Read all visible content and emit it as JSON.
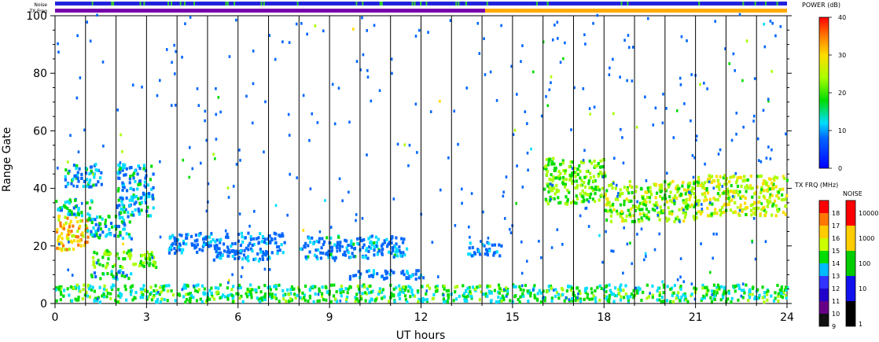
{
  "chart_data": {
    "type": "heatmap",
    "xlabel": "UT hours",
    "ylabel": "Range Gate",
    "xlim": [
      0,
      24
    ],
    "ylim": [
      0,
      100
    ],
    "x_ticks": [
      "0",
      "3",
      "6",
      "9",
      "12",
      "15",
      "18",
      "21",
      "24"
    ],
    "y_ticks": [
      "0",
      "20",
      "40",
      "60",
      "80",
      "100"
    ],
    "top_bar_labels": {
      "noise": "Noise",
      "tx_freq": "TX Freq"
    },
    "tx_freq_change_hour": 14.1,
    "power_colorbar": {
      "title": "POWER (dB)",
      "ticks": [
        "0",
        "10",
        "20",
        "30",
        "40"
      ],
      "range": [
        0,
        40
      ]
    },
    "tx_freq_colorbar": {
      "title": "TX FRQ (MHz)",
      "ticks": [
        "9",
        "10",
        "11",
        "12",
        "13",
        "14",
        "15",
        "16",
        "17",
        "18"
      ]
    },
    "noise_colorbar": {
      "title": "NOISE",
      "ticks": [
        "1",
        "10",
        "100",
        "1000",
        "10000"
      ]
    },
    "echo_regions": [
      {
        "t0": 0.0,
        "t1": 1.1,
        "g0": 18,
        "g1": 30,
        "power": 28
      },
      {
        "t0": 0.0,
        "t1": 1.2,
        "g0": 30,
        "g1": 36,
        "power": 12
      },
      {
        "t0": 0.3,
        "t1": 1.5,
        "g0": 40,
        "g1": 48,
        "power": 8
      },
      {
        "t0": 1.0,
        "t1": 2.5,
        "g0": 22,
        "g1": 30,
        "power": 10
      },
      {
        "t0": 1.2,
        "t1": 3.3,
        "g0": 12,
        "g1": 18,
        "power": 18
      },
      {
        "t0": 1.0,
        "t1": 2.5,
        "g0": 8,
        "g1": 11,
        "power": 12
      },
      {
        "t0": 2.0,
        "t1": 3.2,
        "g0": 30,
        "g1": 48,
        "power": 9
      },
      {
        "t0": 3.7,
        "t1": 7.5,
        "g0": 17,
        "g1": 24,
        "power": 5
      },
      {
        "t0": 5.0,
        "t1": 7.0,
        "g0": 14,
        "g1": 18,
        "power": 6
      },
      {
        "t0": 8.0,
        "t1": 11.5,
        "g0": 15,
        "g1": 23,
        "power": 7
      },
      {
        "t0": 9.5,
        "t1": 12.2,
        "g0": 8,
        "g1": 11,
        "power": 5
      },
      {
        "t0": 13.5,
        "t1": 14.6,
        "g0": 16,
        "g1": 21,
        "power": 6
      },
      {
        "t0": 0.0,
        "t1": 24.0,
        "g0": 0,
        "g1": 6,
        "power": 14
      },
      {
        "t0": 16.0,
        "t1": 18.0,
        "g0": 34,
        "g1": 50,
        "power": 18
      },
      {
        "t0": 18.0,
        "t1": 21.0,
        "g0": 28,
        "g1": 42,
        "power": 20
      },
      {
        "t0": 21.0,
        "t1": 24.0,
        "g0": 30,
        "g1": 44,
        "power": 22
      }
    ]
  }
}
